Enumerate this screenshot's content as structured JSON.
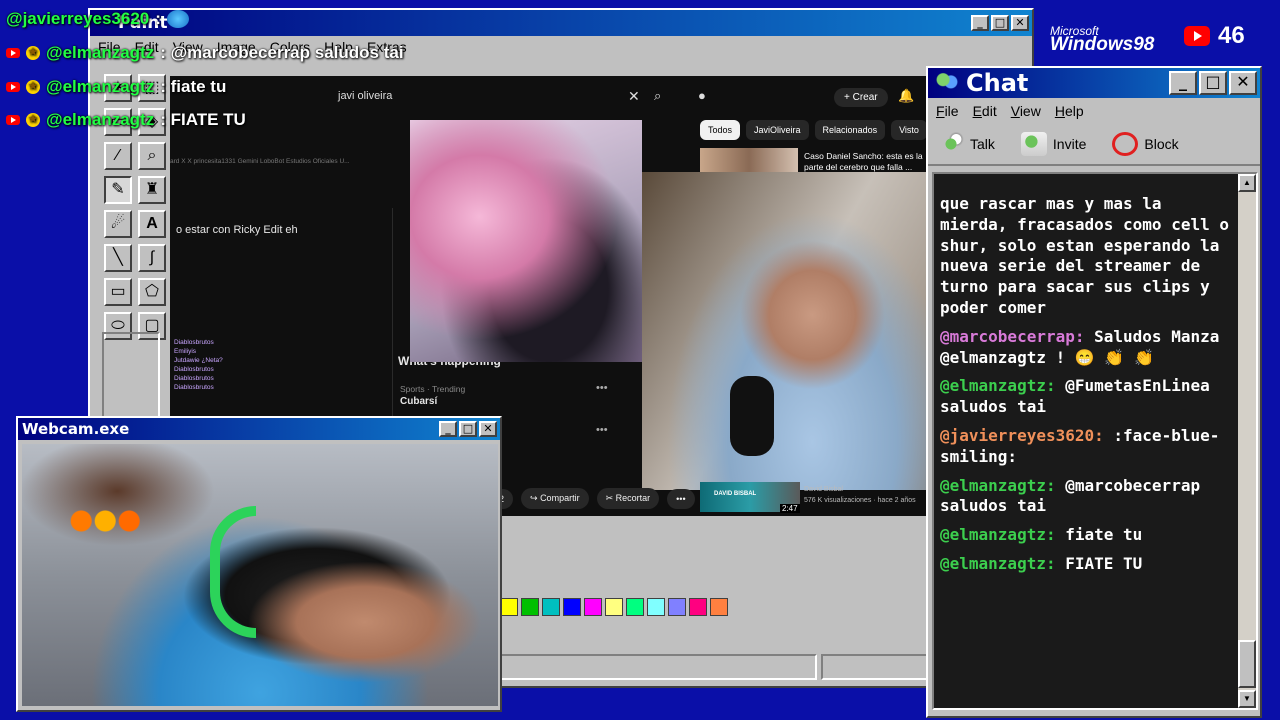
{
  "overlay_chat": [
    {
      "user": "@javierreyes3620",
      "text": ": ",
      "has_badges": false,
      "emoji": true
    },
    {
      "user": "@elmanzagtz",
      "text": ": @marcobecerrap saludos tai",
      "has_badges": true
    },
    {
      "user": "@elmanzagtz",
      "text": ": fiate tu",
      "has_badges": true
    },
    {
      "user": "@elmanzagtz",
      "text": ": FIATE TU",
      "has_badges": true
    }
  ],
  "paint": {
    "title": "Paint",
    "menu": [
      "File",
      "Edit",
      "View",
      "Image",
      "Colors",
      "Help",
      "Extras"
    ],
    "palette": [
      "#ffff00",
      "#00c000",
      "#00c0c0",
      "#0000ff",
      "#ff00ff",
      "#ffff80",
      "#00ff80",
      "#80ffff",
      "#8080ff",
      "#ff0080",
      "#ff8040"
    ]
  },
  "youtube": {
    "search_value": "javi oliveira",
    "crear_label": "Crear",
    "chips": [
      "Todos",
      "JaviOliveira",
      "Relacionados",
      "Visto"
    ],
    "related_title": "Caso Daniel Sancho: esta es la parte del cerebro que falla ...",
    "bookmarks": "ard    X  X   princesita1331    Gemini    LoboBot    Estudios Oficiales U...",
    "overlay_text": "o estar con Ricky Edit eh",
    "whats_happening": "What's happening",
    "sports_trending": "Sports · Trending",
    "trend_topic": "Cubarsí",
    "like_count": "2",
    "share_label": "Compartir",
    "clip_label": "Recortar",
    "endcard_duration": "2:47",
    "endcard_channel": "David Bisbal",
    "endcard_views": "576 K visualizaciones · hace 2 años",
    "endcard_thumb_text": "DAVID BISBAL",
    "mini_chat": [
      "Diablosbrutos  ",
      "Emiliyis",
      "Jutdawie ¿Neta?",
      "Diablosbrutos",
      "Diablosbrutos",
      "Diablosbrutos"
    ]
  },
  "webcam": {
    "title": "Webcam.exe"
  },
  "chat": {
    "title": "Chat",
    "menu": [
      "File",
      "Edit",
      "View",
      "Help"
    ],
    "toolbar": [
      "Talk",
      "Invite",
      "Block"
    ],
    "messages": [
      {
        "user": "",
        "text": "que rascar mas y mas la mierda, fracasados como cell o shur, solo estan esperando la nueva serie del streamer de turno para sacar sus clips y poder comer",
        "color": "white"
      },
      {
        "user": "@marcobecerrap:",
        "text": " Saludos Manza @elmanzagtz ! 😁 👏 👏",
        "color": "pink"
      },
      {
        "user": "@elmanzagtz:",
        "text": " @FumetasEnLinea saludos tai",
        "color": "green"
      },
      {
        "user": "@javierreyes3620:",
        "text": " :face-blue-smiling:",
        "color": "orange"
      },
      {
        "user": "@elmanzagtz:",
        "text": " @marcobecerrap saludos tai",
        "color": "green"
      },
      {
        "user": "@elmanzagtz:",
        "text": " fiate tu",
        "color": "green"
      },
      {
        "user": "@elmanzagtz:",
        "text": " FIATE TU",
        "color": "green"
      }
    ]
  },
  "branding": {
    "ms_small": "Microsoft",
    "ms_big": "Windows98",
    "viewer_count": "46"
  }
}
